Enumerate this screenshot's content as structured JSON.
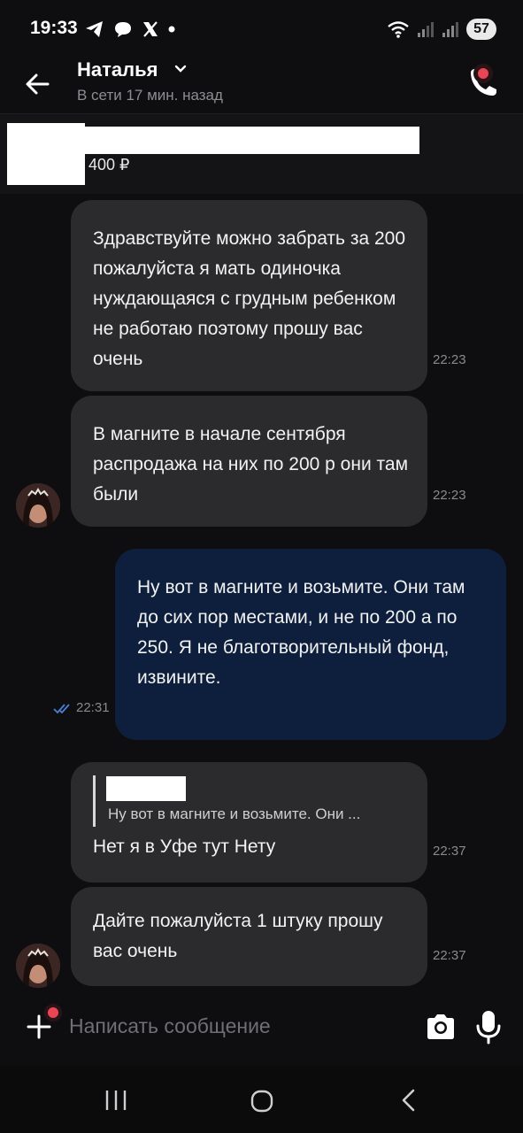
{
  "status_bar": {
    "time": "19:33",
    "battery": "57",
    "wifi_badge": "5"
  },
  "header": {
    "contact_name": "Наталья",
    "contact_status": "В сети 17 мин. назад"
  },
  "product": {
    "price": "400 ₽"
  },
  "messages": [
    {
      "direction": "in",
      "text": "Здравствуйте можно забрать за 200 пожалуйста я мать одиночка нуждающаяся с грудным ребенком не работаю поэтому прошу вас очень",
      "time": "22:23"
    },
    {
      "direction": "in",
      "text": "В магните в начале сентября распродажа на них по 200 р они там были",
      "time": "22:23"
    },
    {
      "direction": "out",
      "text": "Ну вот в магните и возьмите. Они там до сих пор местами, и не по 200 а по 250. Я не благотворительный фонд, извините.",
      "time": "22:31"
    },
    {
      "direction": "in",
      "quote": "Ну вот в магните и возьмите. Они ...",
      "text": "Нет я в Уфе тут Нету",
      "time": "22:37"
    },
    {
      "direction": "in",
      "text": "Дайте пожалуйста 1 штуку прошу вас очень",
      "time": "22:37"
    }
  ],
  "composer": {
    "placeholder": "Написать сообщение"
  },
  "colors": {
    "background": "#0e0e10",
    "incoming_bubble": "#2b2b2e",
    "outgoing_bubble": "#0d1f3c",
    "notification_dot": "#e84655",
    "read_check": "#4a80d6"
  },
  "icons": {
    "back": "arrow-left-icon",
    "call": "phone-icon",
    "attach": "plus-icon",
    "camera": "camera-icon",
    "mic": "microphone-icon"
  }
}
